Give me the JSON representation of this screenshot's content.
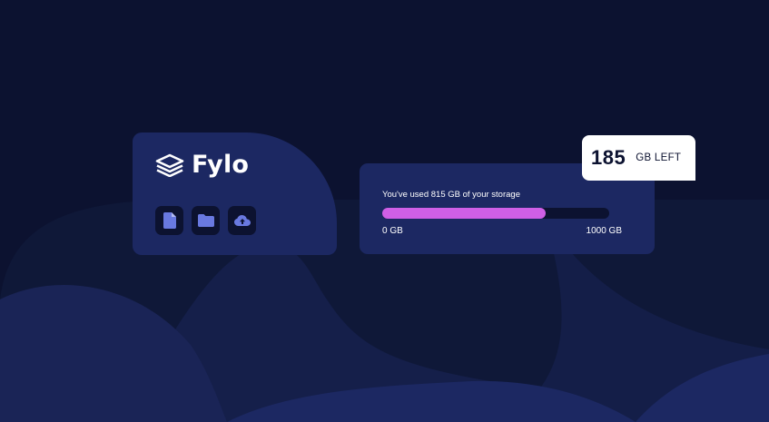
{
  "brand": {
    "name": "Fylo"
  },
  "icons": [
    "document-icon",
    "folder-icon",
    "upload-icon"
  ],
  "storage": {
    "usage_text": "You've used 815 GB of your storage",
    "used_gb": 815,
    "total_gb": 1000,
    "used_fraction": 0.72,
    "min_label": "0 GB",
    "max_label": "1000 GB",
    "remaining_value": "185",
    "remaining_unit": "GB LEFT"
  },
  "colors": {
    "background": "#0c1230",
    "card": "#1c2862",
    "icon": "#6979e0",
    "bar_fill": "#cf5fe6",
    "badge": "#ffffff"
  }
}
